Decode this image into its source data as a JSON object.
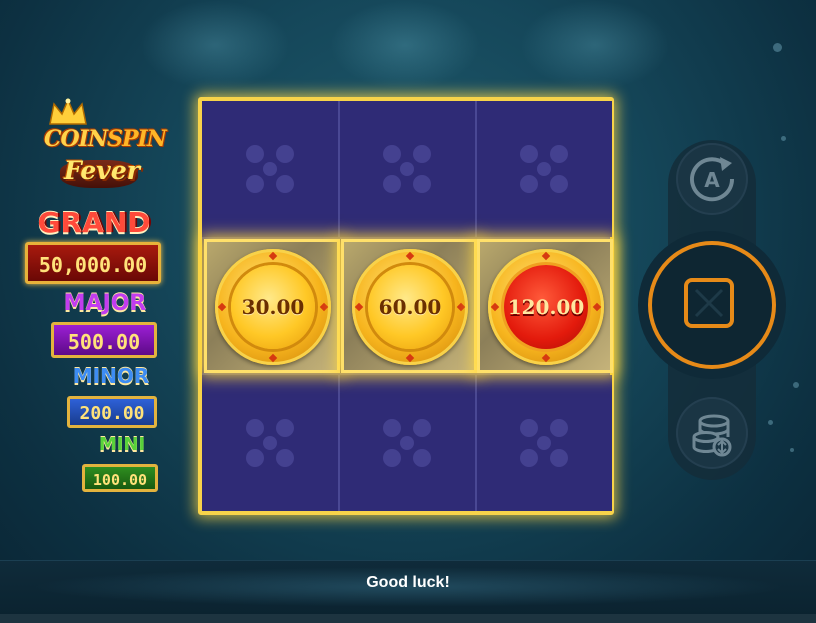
{
  "game": {
    "logo": {
      "line1a": "COIN",
      "line1b": "SPIN",
      "line2": "Fever"
    },
    "jackpots": [
      {
        "label": "GRAND",
        "value": "50,000.00"
      },
      {
        "label": "MAJOR",
        "value": "500.00"
      },
      {
        "label": "MINOR",
        "value": "200.00"
      },
      {
        "label": "MINI",
        "value": "100.00"
      }
    ],
    "reels": {
      "columns": 3,
      "rows": 3,
      "coins": [
        {
          "row": 2,
          "col": 1,
          "value": "30.00",
          "color": "gold"
        },
        {
          "row": 2,
          "col": 2,
          "value": "60.00",
          "color": "gold"
        },
        {
          "row": 2,
          "col": 3,
          "value": "120.00",
          "color": "red"
        }
      ]
    },
    "controls": {
      "autoplay_icon": "autoplay-icon",
      "autoplay_letter": "A",
      "spin_icon": "stop-icon",
      "bet_icon": "coin-stack-icon"
    },
    "status_message": "Good luck!",
    "colors": {
      "frame": "#f7d34a",
      "spin_ring": "#e68a18",
      "grand": "#ff4a3a",
      "major": "#c23cf0",
      "minor": "#3d8cf2",
      "mini": "#58d23a"
    }
  }
}
